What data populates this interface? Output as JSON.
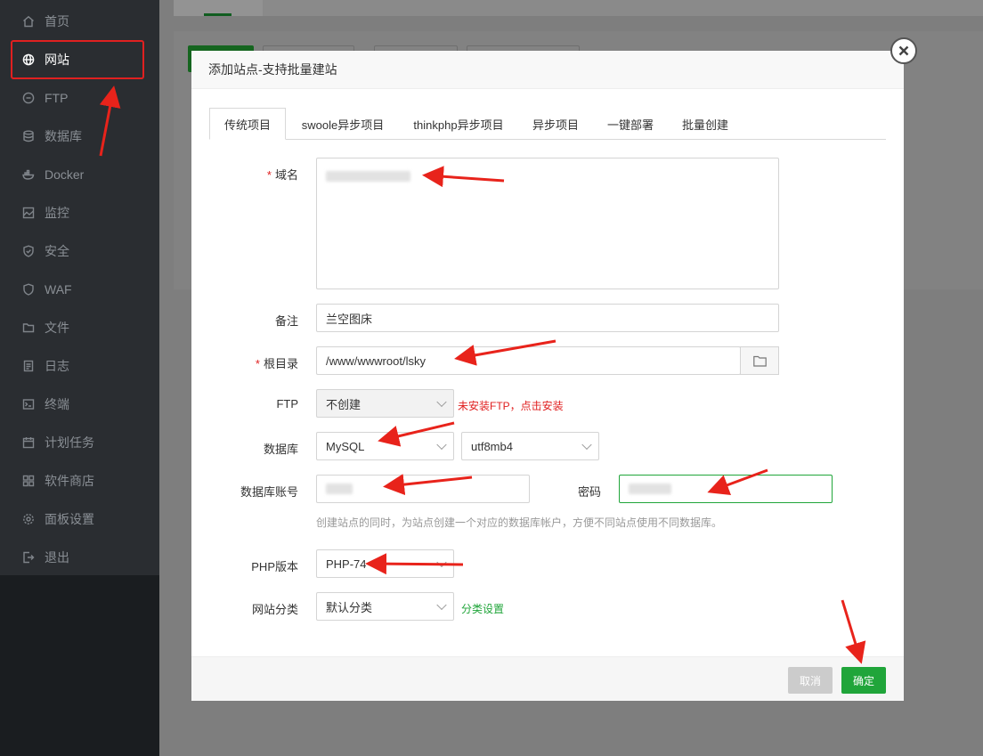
{
  "sidebar": {
    "items": [
      {
        "label": "首页",
        "icon": "home-icon"
      },
      {
        "label": "网站",
        "icon": "globe-icon"
      },
      {
        "label": "FTP",
        "icon": "ftp-icon"
      },
      {
        "label": "数据库",
        "icon": "database-icon"
      },
      {
        "label": "Docker",
        "icon": "docker-icon"
      },
      {
        "label": "监控",
        "icon": "monitor-icon"
      },
      {
        "label": "安全",
        "icon": "shield-icon"
      },
      {
        "label": "WAF",
        "icon": "waf-icon"
      },
      {
        "label": "文件",
        "icon": "folder-icon"
      },
      {
        "label": "日志",
        "icon": "log-icon"
      },
      {
        "label": "终端",
        "icon": "terminal-icon"
      },
      {
        "label": "计划任务",
        "icon": "calendar-icon"
      },
      {
        "label": "软件商店",
        "icon": "apps-icon"
      },
      {
        "label": "面板设置",
        "icon": "gear-icon"
      },
      {
        "label": "退出",
        "icon": "logout-icon"
      }
    ],
    "active": "网站"
  },
  "modal": {
    "title": "添加站点-支持批量建站",
    "tabs": [
      "传统项目",
      "swoole异步项目",
      "thinkphp异步项目",
      "异步项目",
      "一键部署",
      "批量创建"
    ],
    "active_tab": "传统项目",
    "form": {
      "domain_label": "域名",
      "remark_label": "备注",
      "remark_value": "兰空图床",
      "root_label": "根目录",
      "root_value": "/www/wwwroot/lsky",
      "ftp_label": "FTP",
      "ftp_value": "不创建",
      "ftp_note": "未安装FTP，点击安装",
      "db_label": "数据库",
      "db_type": "MySQL",
      "db_charset": "utf8mb4",
      "db_user_label": "数据库账号",
      "db_pass_label": "密码",
      "db_hint": "创建站点的同时，为站点创建一个对应的数据库帐户，方便不同站点使用不同数据库。",
      "php_label": "PHP版本",
      "php_value": "PHP-74",
      "category_label": "网站分类",
      "category_value": "默认分类",
      "category_link": "分类设置"
    },
    "buttons": {
      "cancel": "取消",
      "ok": "确定"
    }
  },
  "colors": {
    "accent": "#20a53a",
    "danger": "#e02020",
    "sidebar_bg": "#2a2d31"
  }
}
